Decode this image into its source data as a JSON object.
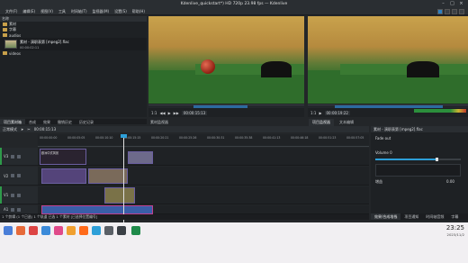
{
  "window": {
    "title": "Kdenlive_quickstart*) HD 720p 23.98 fps — Kdenlive"
  },
  "menu": {
    "items": [
      "文件(F)",
      "编辑(E)",
      "视图(V)",
      "工具",
      "时间轴(T)",
      "监视器(M)",
      "设置(S)",
      "帮助(H)"
    ]
  },
  "bin": {
    "header": "名称",
    "folders": [
      "素材",
      "字幕",
      "audios",
      "videos"
    ],
    "clip": {
      "title": "素材 - 演职表第 [mpeg2].flac",
      "duration": "00:00:02:11"
    }
  },
  "left_tabs": [
    "项目素材箱",
    "合成",
    "效果",
    "撤销历史",
    "历史记录"
  ],
  "monitor_tabs": [
    "项目监视器",
    "素材监视器",
    "文本编辑"
  ],
  "clip_monitor": {
    "timecode": "00:00:15:13",
    "zoom": "1:1"
  },
  "project_monitor": {
    "timecode": "00:00:19:22",
    "zoom": "1:1"
  },
  "timeline": {
    "toolbar": {
      "mode": "正常模式",
      "timecode": "00:00:15:13"
    },
    "ruler_ticks": [
      "00:00:00:00",
      "00:00:05:05",
      "00:00:10:10",
      "00:00:15:15",
      "00:00:20:21",
      "00:00:25:26",
      "00:00:30:31",
      "00:00:35:38",
      "00:00:41:13",
      "00:00:46:18",
      "00:00:51:23",
      "00:00:57:05"
    ],
    "tracks": [
      {
        "name": "V3",
        "clips": [
          {
            "label": "欧洲中式风景"
          },
          {
            "label": ""
          }
        ]
      },
      {
        "name": "V2",
        "clips": [
          {
            "label": ""
          },
          {
            "label": ""
          },
          {
            "label": ""
          }
        ]
      },
      {
        "name": "V1",
        "clips": [
          {
            "label": ""
          }
        ]
      },
      {
        "name": "A1",
        "clips": [
          {
            "label": ""
          }
        ]
      }
    ]
  },
  "effects": {
    "title": "素材 - 演职表第 [mpeg2].flac",
    "subtitle": "Fade out",
    "volume_label": "Volume 0",
    "gain_label": "增益",
    "gain_value": "0.00",
    "tabs": [
      "效果/合成堆栈",
      "项目通知",
      "时间轴音频",
      "字幕"
    ]
  },
  "status": {
    "text": "1 个剪辑 (1 个已选) 1 个轨道 已选 1 个素材 [已选择位置编号]"
  },
  "clock": {
    "time": "23:25",
    "date": "2023/11/2"
  },
  "colors": {
    "accent": "#2d9fd8",
    "audio_clip": "#3a5ea8",
    "video_clip": "#4a3f7a"
  }
}
